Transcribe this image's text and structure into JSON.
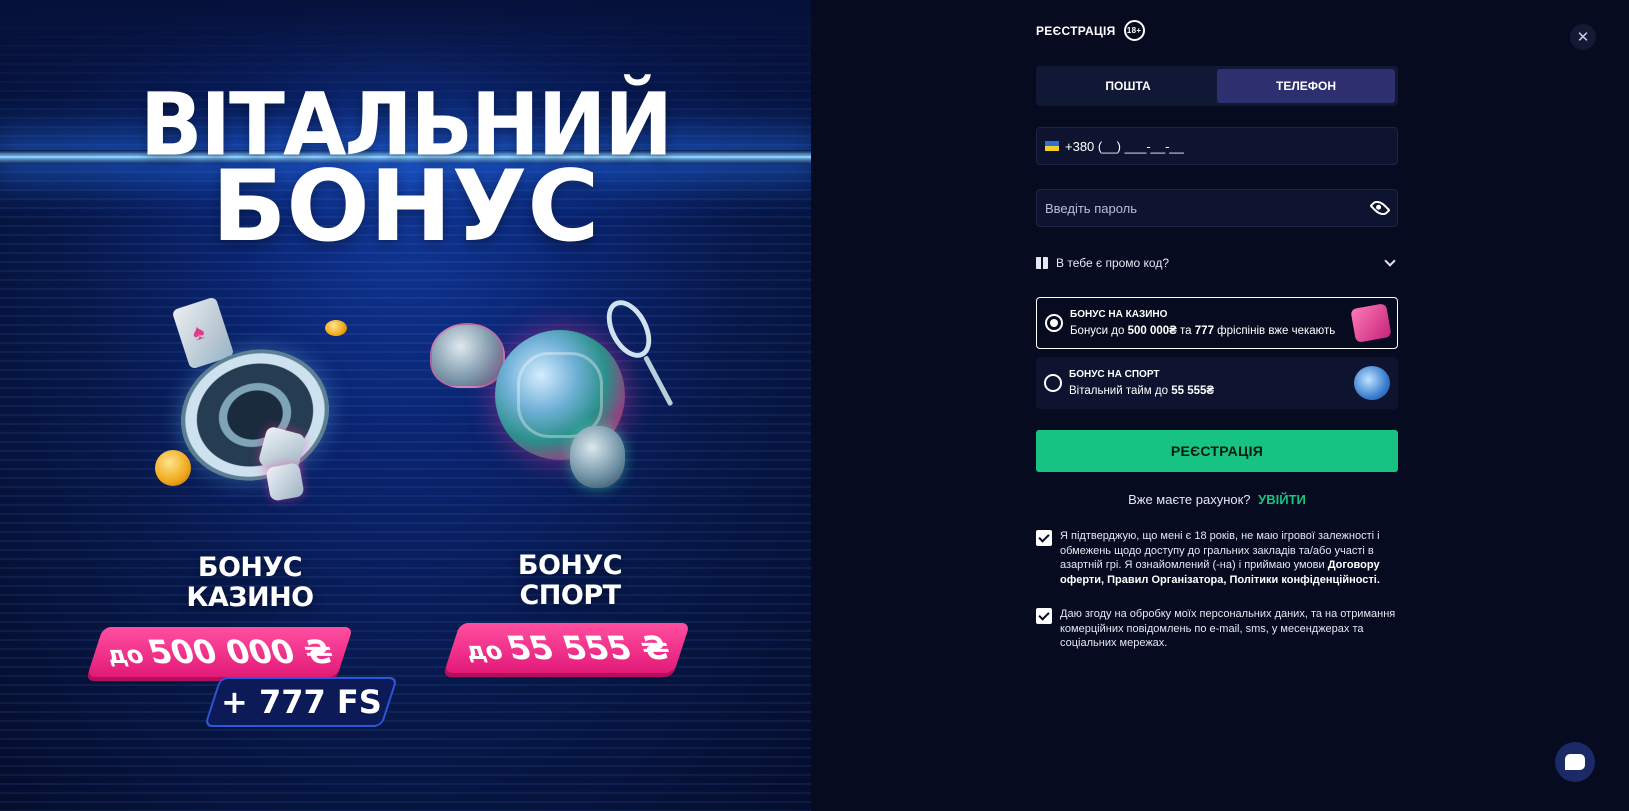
{
  "promo": {
    "title_line1": "ВІТАЛЬНИЙ",
    "title_line2": "БОНУС",
    "casino_label_1": "БОНУС",
    "casino_label_2": "КАЗИНО",
    "casino_prefix": "до",
    "casino_amount": "500 000 ₴",
    "casino_fs": "+ 777 FS",
    "sport_label_1": "БОНУС",
    "sport_label_2": "СПОРТ",
    "sport_prefix": "до",
    "sport_amount": "55 555 ₴"
  },
  "form": {
    "title": "РЕЄСТРАЦІЯ",
    "age_badge": "18+",
    "tabs": [
      {
        "label": "ПОШТА",
        "active": false
      },
      {
        "label": "ТЕЛЕФОН",
        "active": true
      }
    ],
    "phone_value": "+380 (__) ___-__-__",
    "password_placeholder": "Введіть пароль",
    "promo_code_label": "В тебе є промо код?",
    "options": [
      {
        "title": "БОНУС НА КАЗИНО",
        "desc_a": "Бонуси до ",
        "desc_b": "500 000₴",
        "desc_c": " та ",
        "desc_d": "777",
        "desc_e": " фріспінів вже чекають",
        "selected": true
      },
      {
        "title": "БОНУС НА СПОРТ",
        "desc_a": "Вітальний тайм до ",
        "desc_b": "55 555₴",
        "selected": false
      }
    ],
    "submit_label": "РЕЄСТРАЦІЯ",
    "have_account": "Вже маєте рахунок?",
    "login_label": "УВІЙТИ",
    "consent1_text": "Я підтверджую, що мені є 18 років, не маю ігрової залежності і обмежень щодо доступу до гральних закладів та/або участі в азартній грі. Я ознайомлений (-на) і приймаю умови ",
    "consent1_bold": "Договору оферти, Правил Організатора, Політики конфіденційності.",
    "consent2_text": "Даю згоду на обробку моїх персональних даних, та на отримання комерційних повідомлень по e-mail, sms, у месенджерах та соціальних мережах."
  },
  "colors": {
    "accent_green": "#16c383",
    "tab_active": "#2d2f6e",
    "promo_pink": "#e21a78",
    "background": "#070b1f"
  },
  "icons": [
    "close-icon",
    "ua-flag-icon",
    "eye-icon",
    "gift-icon",
    "chevron-down-icon",
    "chat-icon"
  ]
}
